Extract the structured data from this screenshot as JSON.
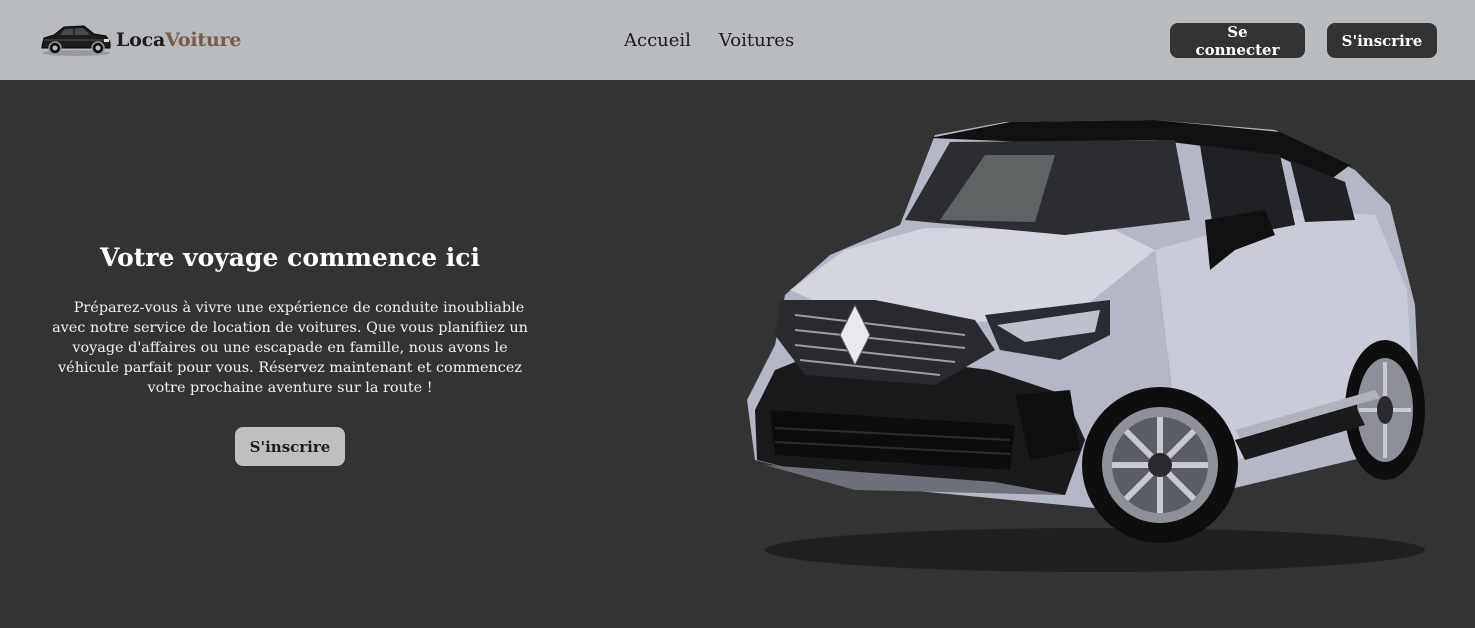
{
  "brand": {
    "part1": "Loca",
    "part2": "Voiture",
    "logo_icon": "car-icon",
    "accent_color": "#7a5a48"
  },
  "nav": {
    "items": [
      {
        "label": "Accueil"
      },
      {
        "label": "Voitures"
      }
    ]
  },
  "auth": {
    "login_label": "Se connecter",
    "signup_label": "S'inscrire"
  },
  "hero": {
    "title": "Votre voyage commence ici",
    "description": "Préparez-vous à vivre une expérience de conduite inoubliable avec notre service de location de voitures. Que vous planifiiez un voyage d'affaires ou une escapade en famille, nous avons le véhicule parfait pour vous. Réservez maintenant et commencez votre prochaine aventure sur la route !",
    "cta_label": "S'inscrire",
    "image_icon": "suv-car-image"
  },
  "colors": {
    "navbar_bg": "#b9bcbe",
    "page_bg": "#333333",
    "button_dark": "#333333",
    "button_light": "#bfbfbf"
  }
}
